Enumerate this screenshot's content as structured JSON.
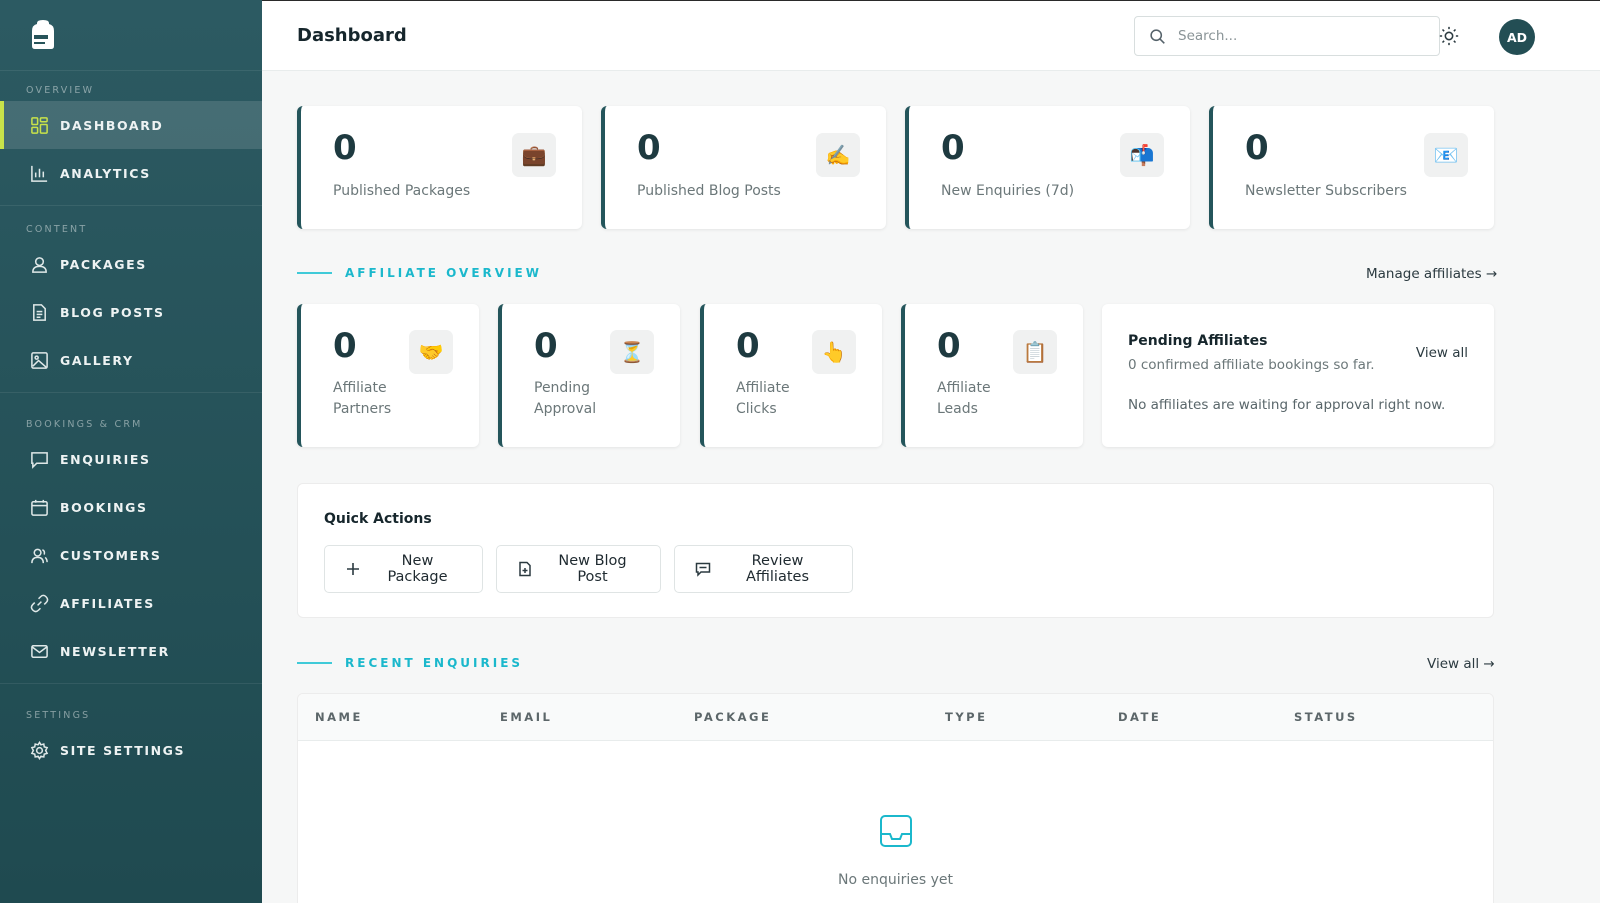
{
  "header": {
    "title": "Dashboard",
    "search_placeholder": "Search...",
    "avatar_initials": "AD"
  },
  "sidebar": {
    "sections": [
      {
        "heading": "OVERVIEW",
        "items": [
          {
            "label": "DASHBOARD",
            "icon": "grid-icon",
            "active": true
          },
          {
            "label": "ANALYTICS",
            "icon": "bar-chart-icon"
          }
        ]
      },
      {
        "heading": "CONTENT",
        "items": [
          {
            "label": "PACKAGES",
            "icon": "user-pin-icon"
          },
          {
            "label": "BLOG POSTS",
            "icon": "document-icon"
          },
          {
            "label": "GALLERY",
            "icon": "image-icon"
          }
        ]
      },
      {
        "heading": "BOOKINGS & CRM",
        "items": [
          {
            "label": "ENQUIRIES",
            "icon": "chat-icon"
          },
          {
            "label": "BOOKINGS",
            "icon": "calendar-icon"
          },
          {
            "label": "CUSTOMERS",
            "icon": "users-icon"
          },
          {
            "label": "AFFILIATES",
            "icon": "link-icon"
          },
          {
            "label": "NEWSLETTER",
            "icon": "mail-icon"
          }
        ]
      },
      {
        "heading": "SETTINGS",
        "items": [
          {
            "label": "SITE SETTINGS",
            "icon": "gear-icon"
          }
        ]
      }
    ]
  },
  "stats": [
    {
      "value": "0",
      "label": "Published Packages",
      "icon": "💼"
    },
    {
      "value": "0",
      "label": "Published Blog Posts",
      "icon": "✍️"
    },
    {
      "value": "0",
      "label": "New Enquiries (7d)",
      "icon": "📬"
    },
    {
      "value": "0",
      "label": "Newsletter Subscribers",
      "icon": "📧"
    }
  ],
  "affiliate": {
    "heading": "AFFILIATE OVERVIEW",
    "manage_link": "Manage affiliates →",
    "cards": [
      {
        "value": "0",
        "label_line1": "Affiliate",
        "label_line2": "Partners",
        "icon": "🤝"
      },
      {
        "value": "0",
        "label_line1": "Pending",
        "label_line2": "Approval",
        "icon": "⏳"
      },
      {
        "value": "0",
        "label_line1": "Affiliate",
        "label_line2": "Clicks",
        "icon": "👆"
      },
      {
        "value": "0",
        "label_line1": "Affiliate",
        "label_line2": "Leads",
        "icon": "📋"
      }
    ],
    "pending": {
      "title": "Pending Affiliates",
      "subtitle": "0 confirmed affiliate bookings so far.",
      "view_all": "View all",
      "empty": "No affiliates are waiting for approval right now."
    }
  },
  "quick_actions": {
    "title": "Quick Actions",
    "buttons": [
      {
        "label": "New Package",
        "icon": "plus-icon"
      },
      {
        "label": "New Blog Post",
        "icon": "file-plus-icon"
      },
      {
        "label": "Review Affiliates",
        "icon": "message-icon"
      }
    ]
  },
  "enquiries": {
    "heading": "RECENT ENQUIRIES",
    "view_all": "View all →",
    "columns": [
      "NAME",
      "EMAIL",
      "PACKAGE",
      "TYPE",
      "DATE",
      "STATUS"
    ],
    "empty": "No enquiries yet"
  },
  "colors": {
    "sidebar": "#1f4a50",
    "accent_active": "#c8e24a",
    "section_heading": "#1bb8cc",
    "card_border": "#24555b"
  }
}
